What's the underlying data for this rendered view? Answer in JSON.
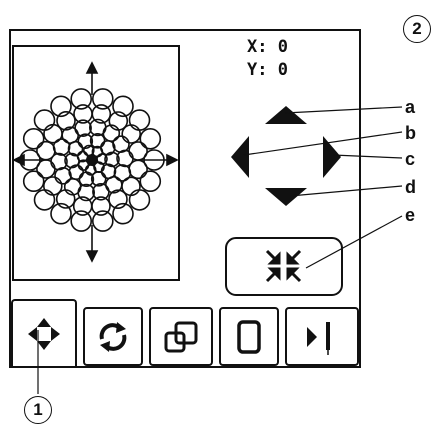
{
  "screen": {
    "coordinates": {
      "x_label": "X:",
      "x_value": "0",
      "y_label": "Y:",
      "y_value": "0"
    },
    "tabs": [
      {
        "icon": "move-icon",
        "active": true
      },
      {
        "icon": "rotate-icon",
        "active": false
      },
      {
        "icon": "resize-icon",
        "active": false
      },
      {
        "icon": "frame-icon",
        "active": false
      },
      {
        "icon": "stitch-icon",
        "active": false
      }
    ],
    "buttons": {
      "up": "up-arrow-icon",
      "left": "left-arrow-icon",
      "right": "right-arrow-icon",
      "down": "down-arrow-icon",
      "center": "center-icon"
    }
  },
  "callouts": {
    "figure_number": "2",
    "tab_number": "1",
    "labels": [
      "a",
      "b",
      "c",
      "d",
      "e"
    ]
  },
  "colors": {
    "ink": "#111111",
    "background": "#ffffff"
  }
}
